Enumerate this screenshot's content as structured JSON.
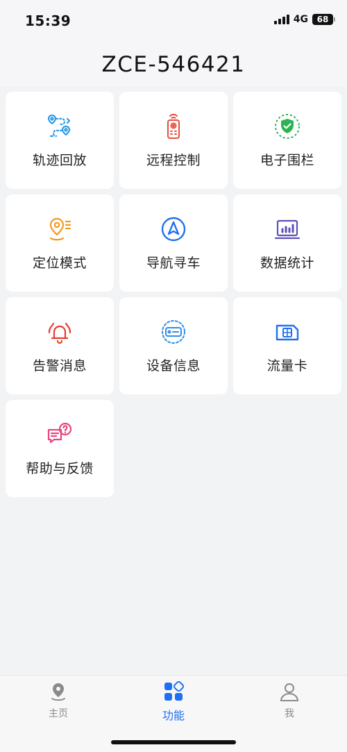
{
  "status": {
    "time": "15:39",
    "network": "4G",
    "battery": "68"
  },
  "header": {
    "title": "ZCE-546421"
  },
  "grid": {
    "items": [
      {
        "label": "轨迹回放",
        "icon": "route-icon"
      },
      {
        "label": "远程控制",
        "icon": "remote-control-icon"
      },
      {
        "label": "电子围栏",
        "icon": "shield-check-icon"
      },
      {
        "label": "定位模式",
        "icon": "location-mode-icon"
      },
      {
        "label": "导航寻车",
        "icon": "navigation-icon"
      },
      {
        "label": "数据统计",
        "icon": "bar-chart-icon"
      },
      {
        "label": "告警消息",
        "icon": "alarm-bell-icon"
      },
      {
        "label": "设备信息",
        "icon": "device-icon"
      },
      {
        "label": "流量卡",
        "icon": "sim-card-icon"
      },
      {
        "label": "帮助与反馈",
        "icon": "help-feedback-icon"
      }
    ]
  },
  "tabbar": {
    "tabs": [
      {
        "label": "主页",
        "icon": "map-pin-icon"
      },
      {
        "label": "功能",
        "icon": "apps-icon"
      },
      {
        "label": "我",
        "icon": "user-icon"
      }
    ]
  },
  "colors": {
    "accent": "#1f6ff2",
    "card": "#ffffff",
    "background": "#f2f3f5"
  }
}
